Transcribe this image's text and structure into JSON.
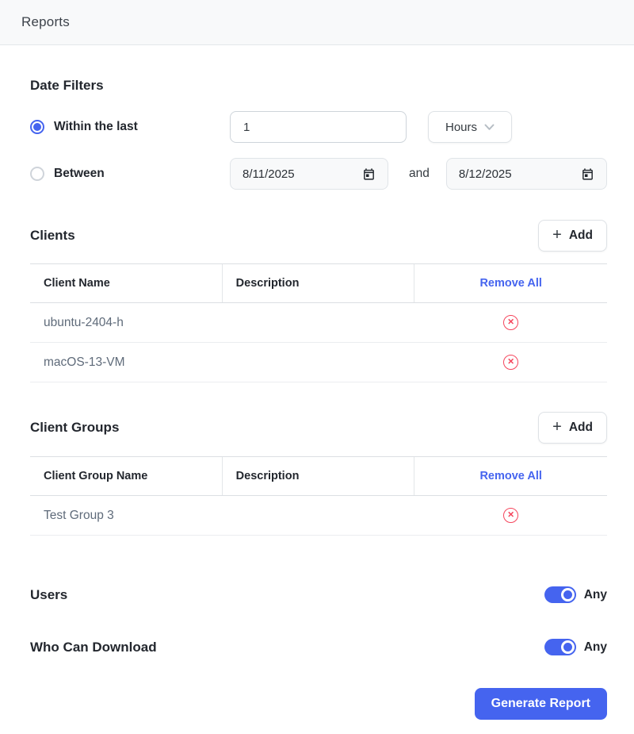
{
  "header": {
    "title": "Reports"
  },
  "date_filters": {
    "heading": "Date Filters",
    "within_last": {
      "label": "Within the last",
      "selected": true,
      "value": "1",
      "unit": "Hours"
    },
    "between": {
      "label": "Between",
      "selected": false,
      "start": "8/11/2025",
      "conjunction": "and",
      "end": "8/12/2025"
    }
  },
  "clients": {
    "heading": "Clients",
    "add_label": "Add",
    "plus_glyph": "+",
    "columns": [
      "Client Name",
      "Description",
      "Remove All"
    ],
    "rows": [
      {
        "name": "ubuntu-2404-h",
        "description": ""
      },
      {
        "name": "macOS-13-VM",
        "description": ""
      }
    ]
  },
  "client_groups": {
    "heading": "Client Groups",
    "add_label": "Add",
    "plus_glyph": "+",
    "columns": [
      "Client Group Name",
      "Description",
      "Remove All"
    ],
    "rows": [
      {
        "name": "Test Group 3",
        "description": ""
      }
    ]
  },
  "toggles": {
    "users": {
      "label": "Users",
      "state_label": "Any",
      "on": true
    },
    "who_can_download": {
      "label": "Who Can Download",
      "state_label": "Any",
      "on": true
    }
  },
  "actions": {
    "generate_label": "Generate Report"
  },
  "icons": {
    "remove_glyph": "✕"
  },
  "colors": {
    "accent": "#4564ef",
    "danger": "#f5455c",
    "header_bg": "#f8f9fa"
  }
}
